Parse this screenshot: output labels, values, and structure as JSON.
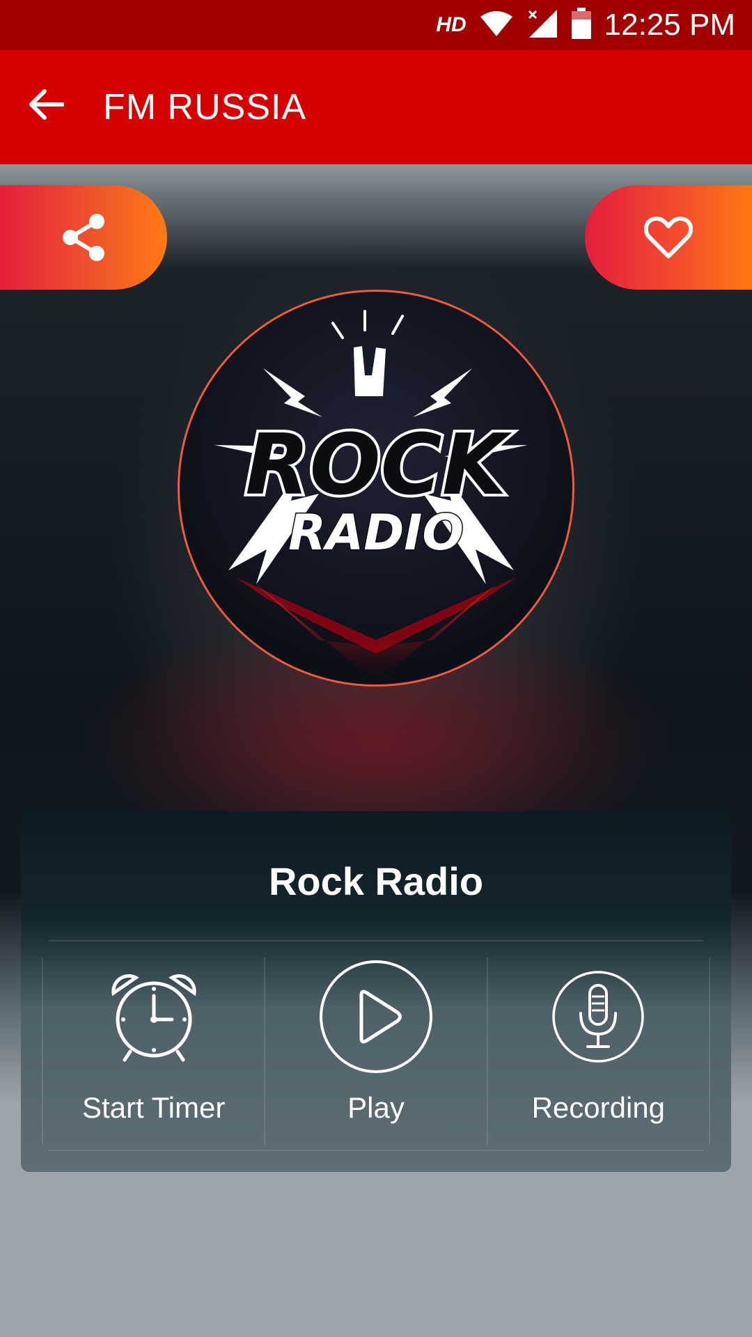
{
  "status_bar": {
    "hd": "HD",
    "time": "12:25 PM",
    "icons": [
      "wifi-icon",
      "signal-icon",
      "battery-icon"
    ]
  },
  "app_bar": {
    "title": "FM RUSSIA",
    "back_icon": "back-arrow-icon",
    "color": "#d50000"
  },
  "actions": {
    "share_icon": "share-icon",
    "favorite_icon": "heart-icon"
  },
  "station": {
    "name": "Rock Radio",
    "logo": {
      "line1": "ROCK",
      "line2": "RADIO"
    }
  },
  "controls": [
    {
      "label": "Start Timer",
      "icon": "alarm-clock-icon"
    },
    {
      "label": "Play",
      "icon": "play-icon"
    },
    {
      "label": "Recording",
      "icon": "microphone-icon"
    }
  ],
  "colors": {
    "status_bar": "#a10000",
    "accent_gradient_start": "#e51f3b",
    "accent_gradient_end": "#ff7a12"
  }
}
